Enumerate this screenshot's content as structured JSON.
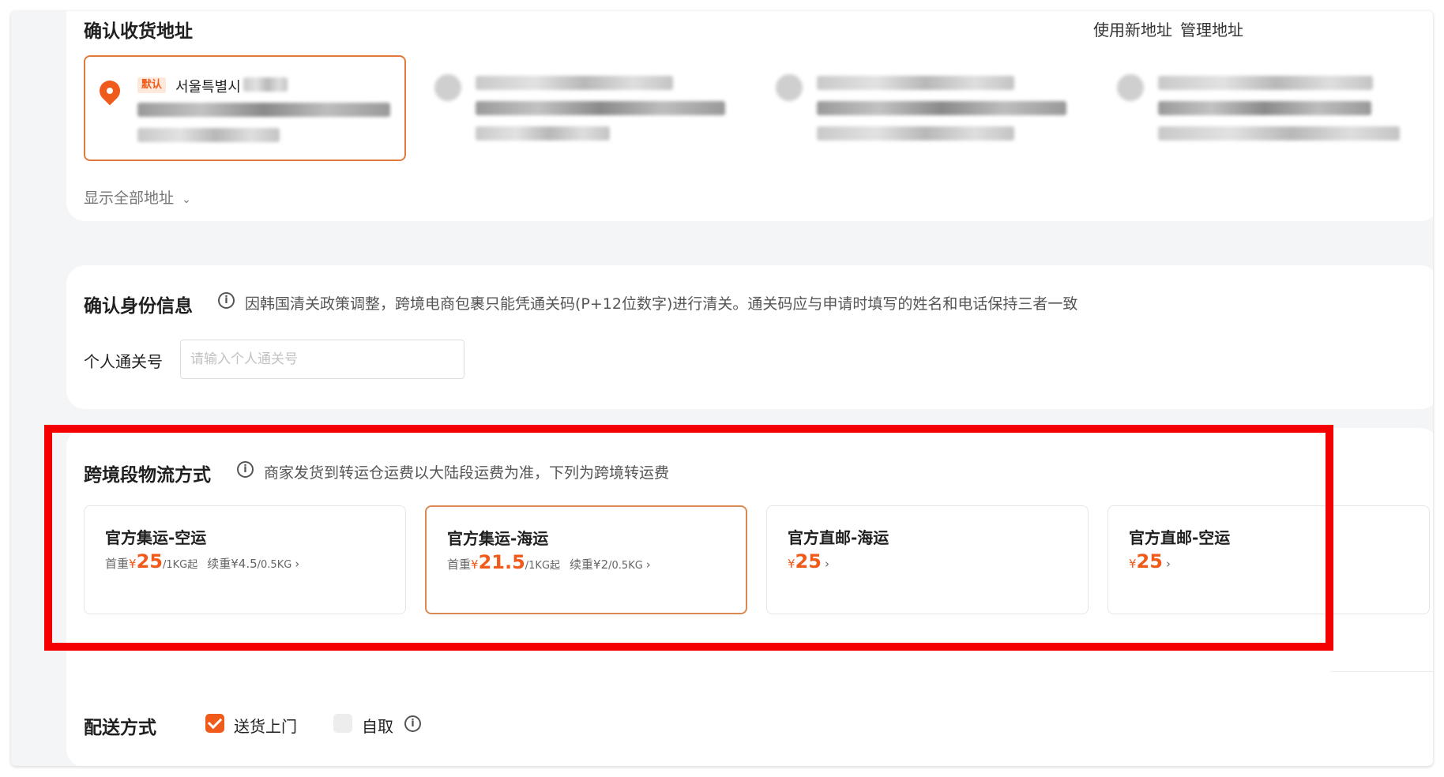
{
  "address": {
    "title": "确认收货地址",
    "use_new_label": "使用新地址",
    "manage_label": "管理地址",
    "default_badge": "默认",
    "default_name": "서울특별시",
    "show_all_label": "显示全部地址"
  },
  "identity": {
    "title": "确认身份信息",
    "notice": "因韩国清关政策调整，跨境电商包裹只能凭通关码(P+12位数字)进行清关。通关码应与申请时填写的姓名和电话保持三者一致",
    "field_label": "个人通关号",
    "field_placeholder": "请输入个人通关号",
    "field_value": ""
  },
  "shipping": {
    "title": "跨境段物流方式",
    "notice": "商家发货到转运仓运费以大陆段运费为准，下列为跨境转运费",
    "options": [
      {
        "name": "官方集运-空运",
        "first_label": "首重",
        "currency": "¥",
        "price": "25",
        "unit": "/1KG起",
        "extra_label": "续重",
        "extra_price": "¥4.5",
        "extra_unit": "/0.5KG",
        "selected": false
      },
      {
        "name": "官方集运-海运",
        "first_label": "首重",
        "currency": "¥",
        "price": "21.5",
        "unit": "/1KG起",
        "extra_label": "续重",
        "extra_price": "¥2",
        "extra_unit": "/0.5KG",
        "selected": true
      },
      {
        "name": "官方直邮-海运",
        "currency": "¥",
        "price": "25",
        "selected": false
      },
      {
        "name": "官方直邮-空运",
        "currency": "¥",
        "price": "25",
        "selected": false
      }
    ]
  },
  "delivery": {
    "title": "配送方式",
    "options": [
      {
        "label": "送货上门",
        "checked": true
      },
      {
        "label": "自取",
        "checked": false
      }
    ]
  },
  "colors": {
    "accent": "#f05a1a",
    "highlight_box": "#f40000",
    "selected_border": "#d98a52"
  }
}
